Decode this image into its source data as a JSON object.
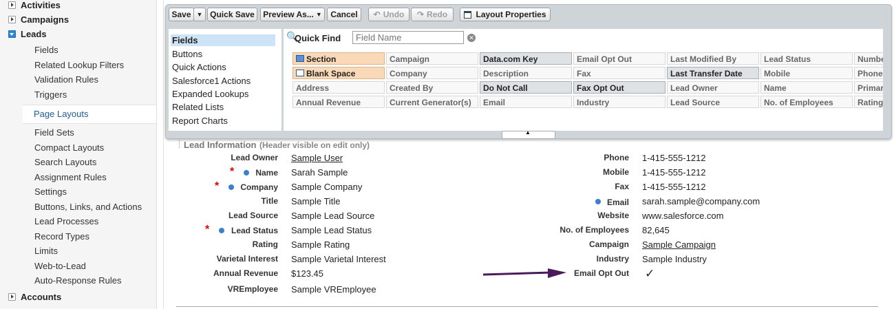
{
  "sidebar": {
    "top_items": [
      "Activities",
      "Campaigns",
      "Leads",
      "Accounts"
    ],
    "lead_children": [
      "Fields",
      "Related Lookup Filters",
      "Validation Rules",
      "Triggers",
      "Page Layouts",
      "Field Sets",
      "Compact Layouts",
      "Search Layouts",
      "Assignment Rules",
      "Settings",
      "Buttons, Links, and Actions",
      "Lead Processes",
      "Record Types",
      "Limits",
      "Web-to-Lead",
      "Auto-Response Rules"
    ]
  },
  "toolbar": {
    "save": "Save",
    "quick_save": "Quick Save",
    "preview": "Preview As...",
    "cancel": "Cancel",
    "undo": "Undo",
    "redo": "Redo",
    "layout_properties": "Layout Properties"
  },
  "palette": {
    "categories": [
      "Fields",
      "Buttons",
      "Quick Actions",
      "Salesforce1 Actions",
      "Expanded Lookups",
      "Related Lists",
      "Report Charts"
    ],
    "quick_find_label": "Quick Find",
    "quick_find_placeholder": "Field Name",
    "fields": [
      [
        "Section",
        "Campaign",
        "Data.com Key",
        "Email Opt Out",
        "Last Modified By",
        "Lead Status",
        "Number"
      ],
      [
        "Blank Space",
        "Company",
        "Description",
        "Fax",
        "Last Transfer Date",
        "Mobile",
        "Phone"
      ],
      [
        "Address",
        "Created By",
        "Do Not Call",
        "Fax Opt Out",
        "Lead Owner",
        "Name",
        "Primary"
      ],
      [
        "Annual Revenue",
        "Current Generator(s)",
        "Email",
        "Industry",
        "Lead Source",
        "No. of Employees",
        "Rating"
      ]
    ]
  },
  "section": {
    "title": "Lead Information",
    "note": "(Header visible on edit only)",
    "left": [
      {
        "label": "Lead Owner",
        "value": "Sample User"
      },
      {
        "label": "Name",
        "value": "Sarah Sample"
      },
      {
        "label": "Company",
        "value": "Sample Company"
      },
      {
        "label": "Title",
        "value": "Sample Title"
      },
      {
        "label": "Lead Source",
        "value": "Sample Lead Source"
      },
      {
        "label": "Lead Status",
        "value": "Sample Lead Status"
      },
      {
        "label": "Rating",
        "value": "Sample Rating"
      },
      {
        "label": "Varietal Interest",
        "value": "Sample Varietal Interest"
      },
      {
        "label": "Annual Revenue",
        "value": "$123.45"
      },
      {
        "label": "VREmployee",
        "value": "Sample VREmployee"
      }
    ],
    "right": [
      {
        "label": "Phone",
        "value": "1-415-555-1212"
      },
      {
        "label": "Mobile",
        "value": "1-415-555-1212"
      },
      {
        "label": "Fax",
        "value": "1-415-555-1212"
      },
      {
        "label": "Email",
        "value": "sarah.sample@company.com"
      },
      {
        "label": "Website",
        "value": "www.salesforce.com"
      },
      {
        "label": "No. of Employees",
        "value": "82,645"
      },
      {
        "label": "Campaign",
        "value": "Sample Campaign"
      },
      {
        "label": "Industry",
        "value": "Sample Industry"
      },
      {
        "label": "Email Opt Out",
        "value": "✓"
      }
    ]
  },
  "colors": {
    "accent": "#1e5a96",
    "arrow": "#4a1a5c",
    "required": "#dd0000"
  }
}
